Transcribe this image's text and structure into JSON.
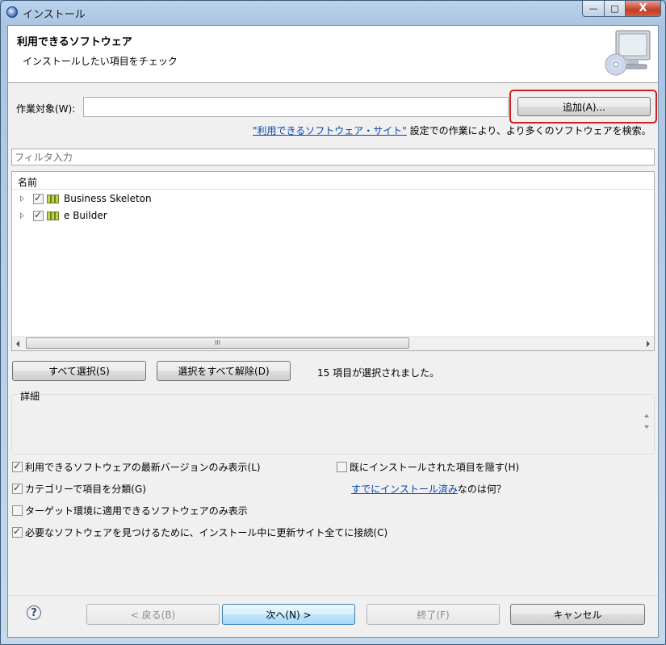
{
  "window": {
    "title": "インストール",
    "minimize_glyph": "—",
    "maximize_glyph": "□",
    "close_glyph": "X"
  },
  "banner": {
    "title": "利用できるソフトウェア",
    "subtitle": "インストールしたい項目をチェック"
  },
  "work_with": {
    "label": "作業対象(W):",
    "value": "",
    "add_button": "追加(A)...",
    "sites_link": "\"利用できるソフトウェア・サイト\"",
    "sites_text": " 設定での作業により、より多くのソフトウェアを検索。"
  },
  "filter": {
    "placeholder": "フィルタ入力"
  },
  "tree": {
    "header": "名前",
    "items": [
      {
        "label": "Business Skeleton",
        "checked": true
      },
      {
        "label": "e Builder",
        "checked": true
      }
    ],
    "scroll_grip": "III"
  },
  "selection": {
    "select_all": "すべて選択(S)",
    "deselect_all": "選択をすべて解除(D)",
    "status": "15 項目が選択されました。"
  },
  "details": {
    "label": "詳細"
  },
  "options": {
    "latest_only": {
      "label": "利用できるソフトウェアの最新バージョンのみ表示(L)",
      "checked": true
    },
    "hide_installed": {
      "label": "既にインストールされた項目を隠す(H)",
      "checked": false
    },
    "group_by_category": {
      "label": "カテゴリーで項目を分類(G)",
      "checked": true
    },
    "installed_link": "すでにインストール済み",
    "installed_link_suffix": "なのは何？",
    "target_only": {
      "label": "ターゲット環境に適用できるソフトウェアのみ表示",
      "checked": false
    },
    "contact_all": {
      "label": "必要なソフトウェアを見つけるために、インストール中に更新サイト全てに接続(C)",
      "checked": true
    }
  },
  "footer": {
    "help": "?",
    "back": "< 戻る(B)",
    "next": "次へ(N) >",
    "finish": "終了(F)",
    "cancel": "キャンセル"
  }
}
